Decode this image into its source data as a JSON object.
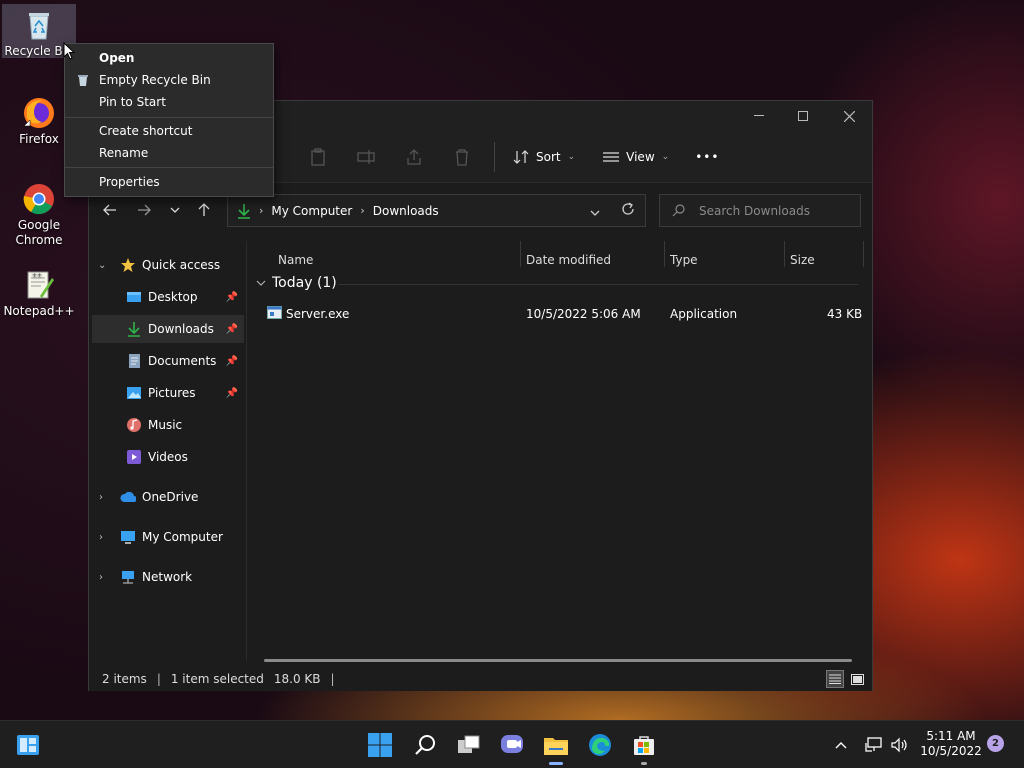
{
  "desktop": {
    "icons": [
      {
        "label": "Recycle Bin"
      },
      {
        "label": "Firefox"
      },
      {
        "label": "Google Chrome"
      },
      {
        "label": "Notepad++"
      }
    ]
  },
  "context_menu": {
    "items": [
      {
        "label": "Open"
      },
      {
        "label": "Empty Recycle Bin"
      },
      {
        "label": "Pin to Start"
      },
      {
        "label": "Create shortcut"
      },
      {
        "label": "Rename"
      },
      {
        "label": "Properties"
      }
    ]
  },
  "explorer": {
    "toolbar": {
      "sort_label": "Sort",
      "view_label": "View",
      "more_label": "•••"
    },
    "address": {
      "crumbs": [
        "My Computer",
        "Downloads"
      ]
    },
    "search": {
      "placeholder": "Search Downloads"
    },
    "nav": {
      "quick_access": "Quick access",
      "items": [
        {
          "label": "Desktop"
        },
        {
          "label": "Downloads"
        },
        {
          "label": "Documents"
        },
        {
          "label": "Pictures"
        },
        {
          "label": "Music"
        },
        {
          "label": "Videos"
        }
      ],
      "onedrive": "OneDrive",
      "my_computer": "My Computer",
      "network": "Network"
    },
    "columns": {
      "name": "Name",
      "date": "Date modified",
      "type": "Type",
      "size": "Size"
    },
    "group": {
      "label": "Today (1)"
    },
    "files": [
      {
        "name": "Server.exe",
        "date": "10/5/2022 5:06 AM",
        "type": "Application",
        "size": "43 KB"
      }
    ],
    "status": {
      "items": "2 items",
      "selected": "1 item selected",
      "size": "18.0 KB"
    }
  },
  "taskbar": {
    "time": "5:11 AM",
    "date": "10/5/2022",
    "notification_count": "2"
  },
  "colors": {
    "accent_green": "#2fb34a",
    "folder_yellow": "#f0c040",
    "win_blue": "#3aa0f0"
  }
}
